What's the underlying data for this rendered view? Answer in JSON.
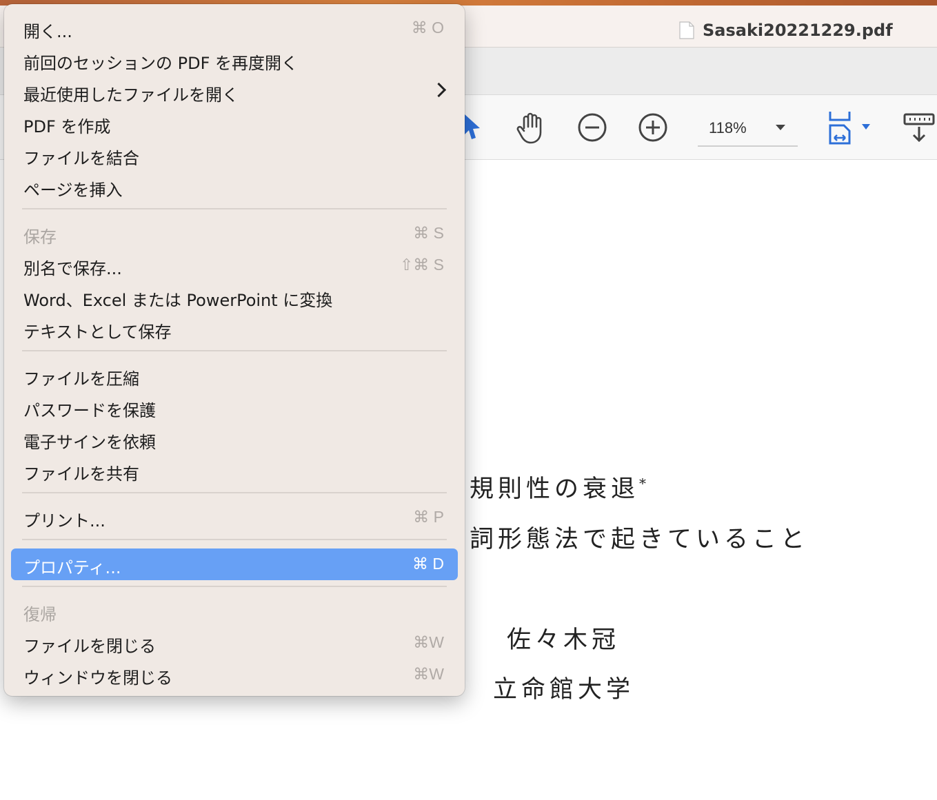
{
  "window": {
    "filename": "Sasaki20221229.pdf"
  },
  "toolbar": {
    "zoom": "118%"
  },
  "document": {
    "title_line": "不規則性の衰退",
    "title_mark": "*",
    "subtitle_line": "動詞形態法で起きていること",
    "author": "佐々木冠",
    "affiliation": "立命館大学"
  },
  "menu": {
    "open": {
      "label": "開く...",
      "shortcut": "⌘ O"
    },
    "reopen": {
      "label": "前回のセッションの PDF を再度開く"
    },
    "recent": {
      "label": "最近使用したファイルを開く"
    },
    "create": {
      "label": "PDF を作成"
    },
    "combine": {
      "label": "ファイルを結合"
    },
    "insert": {
      "label": "ページを挿入"
    },
    "save": {
      "label": "保存",
      "shortcut": "⌘ S"
    },
    "saveas": {
      "label": "別名で保存...",
      "shortcut": "⇧⌘ S"
    },
    "convert": {
      "label": "Word、Excel または PowerPoint に変換"
    },
    "savetext": {
      "label": "テキストとして保存"
    },
    "compress": {
      "label": "ファイルを圧縮"
    },
    "password": {
      "label": "パスワードを保護"
    },
    "esign": {
      "label": "電子サインを依頼"
    },
    "share": {
      "label": "ファイルを共有"
    },
    "print": {
      "label": "プリント...",
      "shortcut": "⌘ P"
    },
    "properties": {
      "label": "プロパティ...",
      "shortcut": "⌘ D"
    },
    "revert": {
      "label": "復帰"
    },
    "closefile": {
      "label": "ファイルを閉じる",
      "shortcut": "⌘W"
    },
    "closewindow": {
      "label": "ウィンドウを閉じる",
      "shortcut": "⌘W"
    }
  }
}
